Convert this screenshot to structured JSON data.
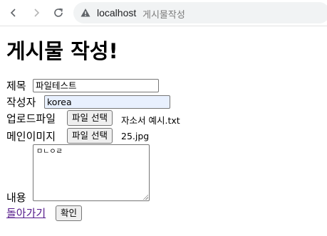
{
  "browser": {
    "host": "localhost",
    "tab_path": "게시물작성"
  },
  "page": {
    "heading": "게시물 작성!",
    "title_label": "제목",
    "title_value": "파일테스트",
    "author_label": "작성자",
    "author_value": "korea",
    "upload_label": "업로드파일",
    "upload_button": "파일 선택",
    "upload_file": "자소서 예시.txt",
    "main_image_label": "메인이미지",
    "main_image_button": "파일 선택",
    "main_image_file": "25.jpg",
    "content_label": "내용",
    "content_value": "ㅁㄴㅇㄹ",
    "back_link": "돌아가기",
    "confirm_button": "확인"
  },
  "colors": {
    "link": "#551a8b",
    "autofill": "#e8f0fe"
  }
}
